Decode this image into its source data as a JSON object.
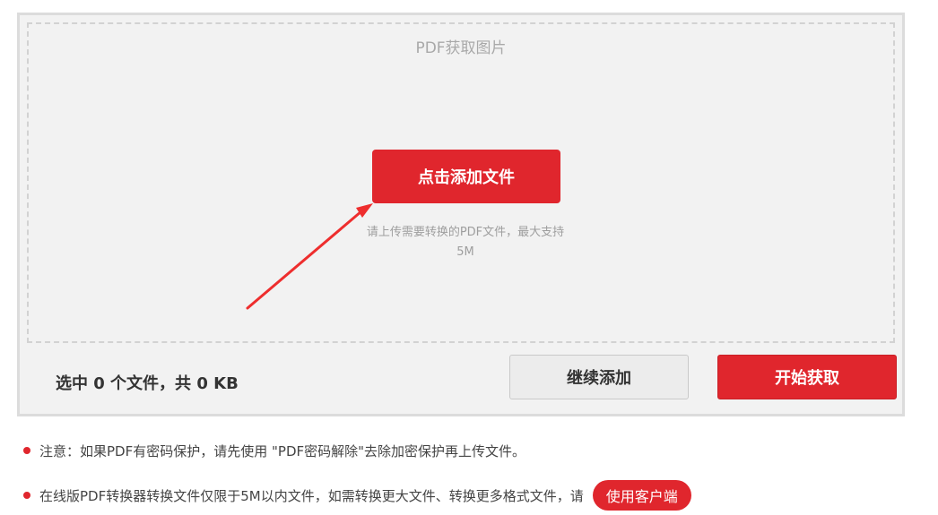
{
  "converter": {
    "title": "PDF获取图片",
    "add_file_button": "点击添加文件",
    "upload_hint_line1": "请上传需要转换的PDF文件，最大支持",
    "upload_hint_line2": "5M",
    "selection_summary": "选中 0 个文件，共 0 KB",
    "continue_add_button": "继续添加",
    "start_button": "开始获取"
  },
  "notes": {
    "note1": "注意：如果PDF有密码保护，请先使用 \"PDF密码解除\"去除加密保护再上传文件。",
    "note2": "在线版PDF转换器转换文件仅限于5M以内文件，如需转换更大文件、转换更多格式文件，请",
    "client_button": "使用客户端"
  },
  "colors": {
    "accent": "#e0262d",
    "panel_bg": "#f2f2f2"
  }
}
